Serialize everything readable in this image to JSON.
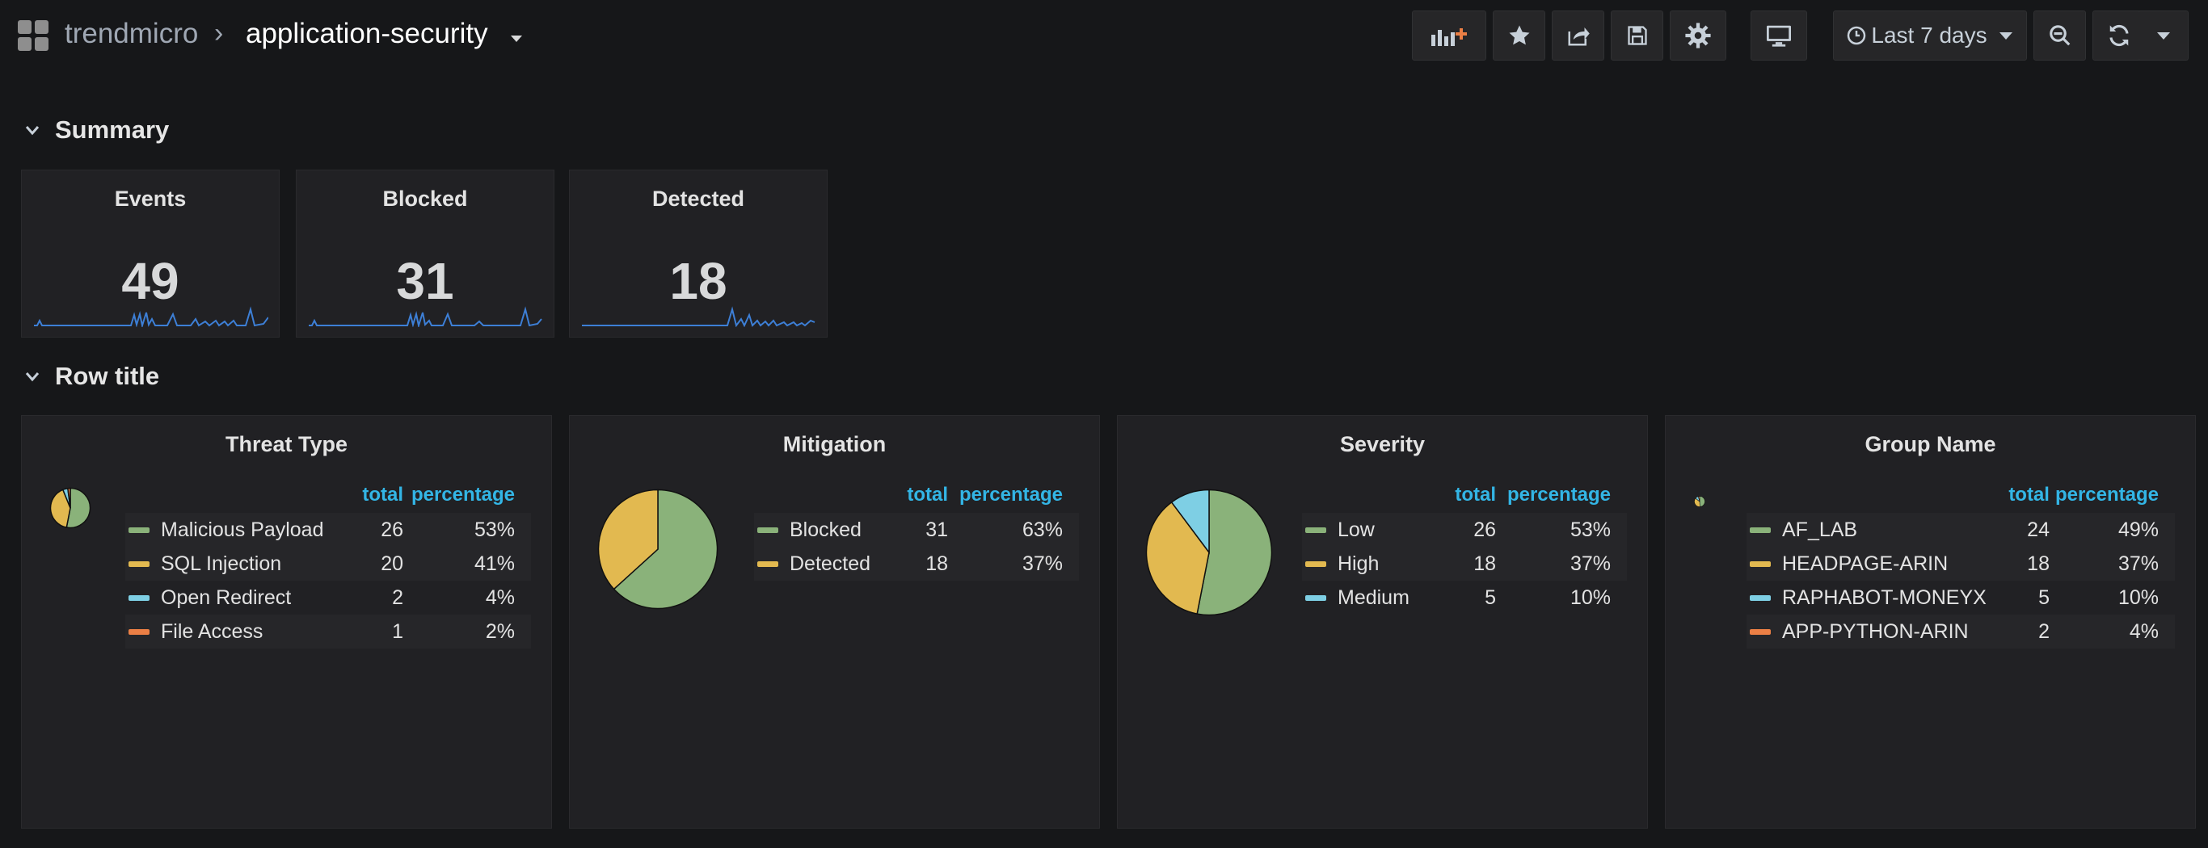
{
  "navbar": {
    "org": "trendmicro",
    "separator": "›",
    "dashboard": "application-security",
    "time_range": "Last 7 days",
    "icons": [
      "add-panel-icon",
      "star-icon",
      "share-icon",
      "save-icon",
      "gear-icon",
      "tv-monitor-icon",
      "clock-icon",
      "zoom-out-icon",
      "refresh-icon",
      "caret-down-icon"
    ]
  },
  "rows": [
    {
      "title": "Summary"
    },
    {
      "title": "Row title"
    }
  ],
  "stats": [
    {
      "title": "Events",
      "value": "49"
    },
    {
      "title": "Blocked",
      "value": "31"
    },
    {
      "title": "Detected",
      "value": "18"
    }
  ],
  "colors": {
    "green": "#8ab27a",
    "yellow": "#e2b950",
    "blue": "#7ecfe4",
    "orange": "#eb7f45",
    "header": "#33b5e5",
    "spark": "#3d7fd6"
  },
  "pies": [
    {
      "title": "Threat Type",
      "col_total": "total",
      "col_pct": "percentage",
      "items": [
        {
          "name": "Malicious Payload",
          "total": "26",
          "pct": "53%",
          "color": "#8ab27a",
          "value": 26
        },
        {
          "name": "SQL Injection",
          "total": "20",
          "pct": "41%",
          "color": "#e2b950",
          "value": 20
        },
        {
          "name": "Open Redirect",
          "total": "2",
          "pct": "4%",
          "color": "#7ecfe4",
          "value": 2
        },
        {
          "name": "File Access",
          "total": "1",
          "pct": "2%",
          "color": "#eb7f45",
          "value": 1
        }
      ]
    },
    {
      "title": "Mitigation",
      "col_total": "total",
      "col_pct": "percentage",
      "items": [
        {
          "name": "Blocked",
          "total": "31",
          "pct": "63%",
          "color": "#8ab27a",
          "value": 31
        },
        {
          "name": "Detected",
          "total": "18",
          "pct": "37%",
          "color": "#e2b950",
          "value": 18
        }
      ]
    },
    {
      "title": "Severity",
      "col_total": "total",
      "col_pct": "percentage",
      "items": [
        {
          "name": "Low",
          "total": "26",
          "pct": "53%",
          "color": "#8ab27a",
          "value": 26
        },
        {
          "name": "High",
          "total": "18",
          "pct": "37%",
          "color": "#e2b950",
          "value": 18
        },
        {
          "name": "Medium",
          "total": "5",
          "pct": "10%",
          "color": "#7ecfe4",
          "value": 5
        }
      ]
    },
    {
      "title": "Group Name",
      "col_total": "total",
      "col_pct": "percentage",
      "items": [
        {
          "name": "AF_LAB",
          "total": "24",
          "pct": "49%",
          "color": "#8ab27a",
          "value": 24
        },
        {
          "name": "HEADPAGE-ARIN",
          "total": "18",
          "pct": "37%",
          "color": "#e2b950",
          "value": 18
        },
        {
          "name": "RAPHABOT-MONEYX",
          "total": "5",
          "pct": "10%",
          "color": "#7ecfe4",
          "value": 5
        },
        {
          "name": "APP-PYTHON-ARIN",
          "total": "2",
          "pct": "4%",
          "color": "#eb7f45",
          "value": 2
        }
      ]
    }
  ]
}
